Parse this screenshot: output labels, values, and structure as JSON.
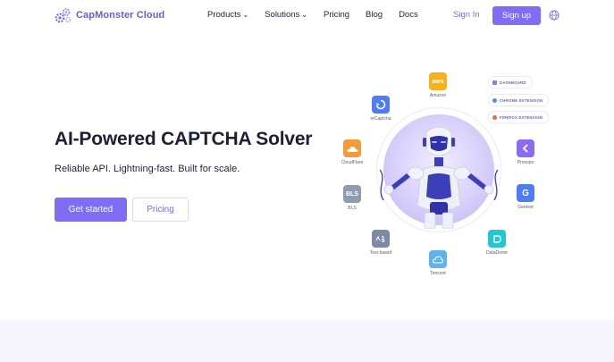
{
  "brand": {
    "name": "CapMonster Cloud"
  },
  "nav": {
    "items": [
      {
        "label": "Products",
        "dropdown": true
      },
      {
        "label": "Solutions",
        "dropdown": true
      },
      {
        "label": "Pricing",
        "dropdown": false
      },
      {
        "label": "Blog",
        "dropdown": false
      },
      {
        "label": "Docs",
        "dropdown": false
      }
    ],
    "signin": "Sign In",
    "signup": "Sign up"
  },
  "hero": {
    "title": "AI-Powered CAPTCHA Solver",
    "subtitle": "Reliable API. Lightning-fast. Built for scale.",
    "primary_cta": "Get started",
    "secondary_cta": "Pricing"
  },
  "illustration": {
    "services": [
      {
        "name": "reCaptcha",
        "icon": "recaptcha-icon",
        "color": "#4f7cf5"
      },
      {
        "name": "Amazon",
        "icon": "aws-icon",
        "color": "#f5b21b",
        "badge": "aws"
      },
      {
        "name": "CloudFlare",
        "icon": "cloudflare-icon",
        "color": "#f39a3b"
      },
      {
        "name": "Prosopo",
        "icon": "prosopo-icon",
        "color": "#8b6cf0"
      },
      {
        "name": "BLS",
        "icon": "bls-icon",
        "color": "#8e9bb0",
        "badge": "BLS"
      },
      {
        "name": "Geetest",
        "icon": "geetest-icon",
        "color": "#4f7cf5",
        "badge": "G"
      },
      {
        "name": "Text-based",
        "icon": "text-captcha-icon",
        "color": "#7c8aa8"
      },
      {
        "name": "Tencent",
        "icon": "tencent-icon",
        "color": "#5fb2ee"
      },
      {
        "name": "DataDome",
        "icon": "datadome-icon",
        "color": "#24c6d3"
      }
    ],
    "extensions": [
      {
        "label": "DASHBOARD",
        "icon": "dashboard-icon",
        "color": "#8a7cf0"
      },
      {
        "label": "CHROME EXTENSION",
        "icon": "chrome-icon",
        "color": "#4f8ff5"
      },
      {
        "label": "FIREFOX EXTENSION",
        "icon": "firefox-icon",
        "color": "#f06a3b"
      }
    ]
  }
}
